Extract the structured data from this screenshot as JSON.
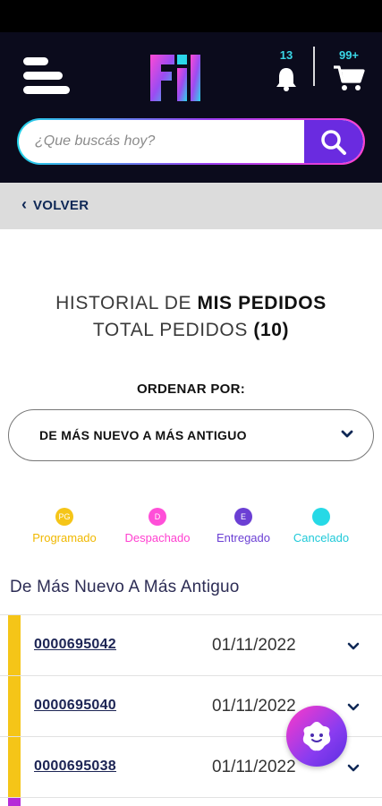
{
  "colors": {
    "header_bg": "#0b0b1c",
    "accent_purple": "#6a2be0",
    "badge_cyan": "#3ad7e7",
    "status_programado": "#f5c518",
    "status_despachado": "#ff4fd8",
    "status_entregado": "#6b3fd4",
    "status_cancelado": "#26d9e6"
  },
  "header": {
    "logo_icon": "fil-logo",
    "menu_icon": "hamburger-menu-icon",
    "notifications": {
      "icon": "bell-icon",
      "count": "13"
    },
    "cart": {
      "icon": "cart-icon",
      "count": "99+"
    }
  },
  "search": {
    "placeholder": "¿Que buscás hoy?",
    "button_icon": "search-icon"
  },
  "nav": {
    "back_label": "VOLVER"
  },
  "page": {
    "title_prefix": "HISTORIAL DE ",
    "title_bold": "MIS PEDIDOS",
    "total_prefix": "TOTAL PEDIDOS ",
    "total_count": "(10)"
  },
  "sort": {
    "label": "ORDENAR POR:",
    "selected": "DE MÁS NUEVO A MÁS ANTIGUO"
  },
  "legend": [
    {
      "abbr": "PG",
      "name": "Programado",
      "color": "#f5c518"
    },
    {
      "abbr": "D",
      "name": "Despachado",
      "color": "#ff4fd8"
    },
    {
      "abbr": "E",
      "name": "Entregado",
      "color": "#6b3fd4"
    },
    {
      "abbr": "",
      "name": "Cancelado",
      "color": "#26d9e6"
    }
  ],
  "list_heading": "De Más Nuevo A Más Antiguo",
  "orders": [
    {
      "number": "0000695042",
      "date": "01/11/2022",
      "status": "Programado"
    },
    {
      "number": "0000695040",
      "date": "01/11/2022",
      "status": "Programado"
    },
    {
      "number": "0000695038",
      "date": "01/11/2022",
      "status": "Programado"
    }
  ],
  "assistant": {
    "icon": "chat-assistant-icon"
  }
}
